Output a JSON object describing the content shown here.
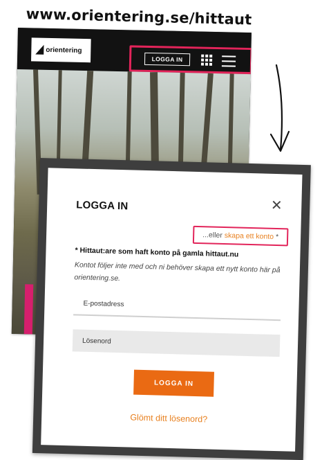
{
  "caption": {
    "url": "www.orientering.se/hittaut"
  },
  "site_header": {
    "logo_text": "orientering",
    "login_label": "LOGGA IN"
  },
  "modal": {
    "title": "LOGGA IN",
    "alt_prefix": "...eller",
    "alt_link": "skapa ett konto",
    "alt_suffix": "*",
    "notice": "* Hittaut:are som haft konto på gamla hittaut.nu",
    "notice_desc": "Kontot följer inte med och ni behöver skapa ett nytt konto här på orientering.se.",
    "email_placeholder": "E-postadress",
    "password_placeholder": "Lösenord",
    "submit_label": "LOGGA IN",
    "forgot_link": "Glömt ditt lösenord?"
  },
  "colors": {
    "accent_orange": "#ea6a13",
    "highlight_pink": "#e2245a",
    "header_black": "#121212"
  },
  "icons": [
    "grid-icon",
    "menu-icon",
    "close-icon",
    "arrow-down-icon"
  ]
}
